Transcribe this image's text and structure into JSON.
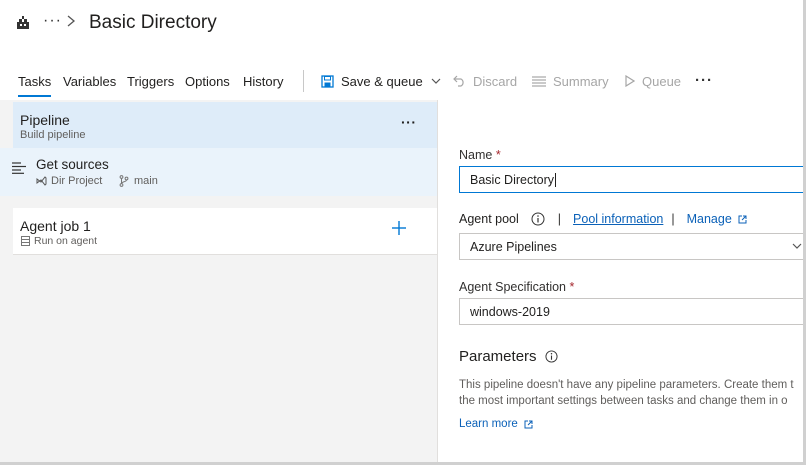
{
  "header": {
    "breadcrumb_more": "···",
    "title": "Basic Directory"
  },
  "toolbar": {
    "tabs": [
      {
        "label": "Tasks",
        "active": true
      },
      {
        "label": "Variables"
      },
      {
        "label": "Triggers"
      },
      {
        "label": "Options"
      },
      {
        "label": "History"
      }
    ],
    "save_queue_label": "Save & queue",
    "discard_label": "Discard",
    "summary_label": "Summary",
    "queue_label": "Queue",
    "more_label": "···"
  },
  "left": {
    "pipeline": {
      "title": "Pipeline",
      "subtitle": "Build pipeline",
      "more": "···"
    },
    "sources": {
      "title": "Get sources",
      "project": "Dir Project",
      "branch": "main"
    },
    "agent_job": {
      "title": "Agent job 1",
      "subtitle": "Run on agent"
    }
  },
  "right": {
    "name_label": "Name",
    "name_required": "*",
    "name_value": "Basic Directory",
    "agent_pool_label": "Agent pool",
    "pool_info_link": "Pool information",
    "manage_link": "Manage",
    "agent_pool_value": "Azure Pipelines",
    "agent_spec_label": "Agent Specification",
    "agent_spec_required": "*",
    "agent_spec_value": "windows-2019",
    "parameters_title": "Parameters",
    "parameters_desc_line1": "This pipeline doesn't have any pipeline parameters. Create them t",
    "parameters_desc_line2": "the most important settings between tasks and change them in o",
    "learn_more": "Learn more"
  },
  "colors": {
    "accent": "#0078d4",
    "link": "#0b61b8",
    "selected_row": "#deecf9",
    "panel_bg": "#f3f3f3",
    "required": "#a4262c"
  }
}
